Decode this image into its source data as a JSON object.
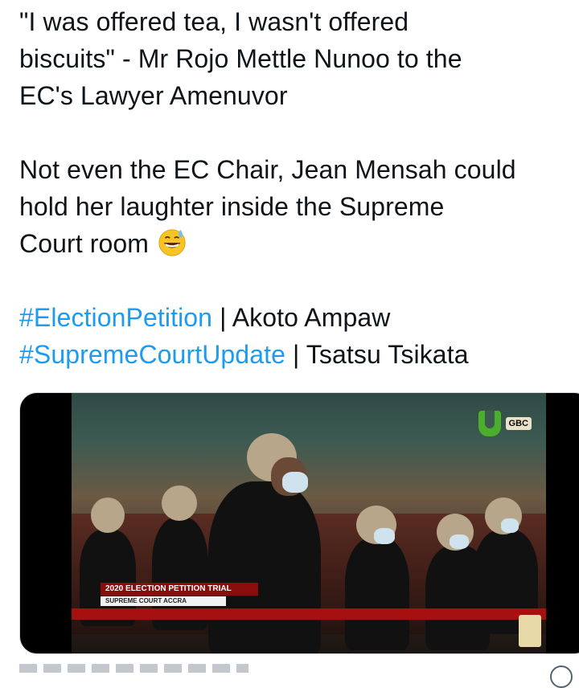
{
  "tweet": {
    "lines": [
      "\"I was offered tea, I wasn't offered",
      "biscuits\" - Mr Rojo Mettle Nunoo to the",
      "EC's Lawyer Amenuvor"
    ],
    "lines2": [
      "Not even the EC Chair, Jean Mensah could",
      "hold her laughter inside the Supreme",
      "Court room"
    ],
    "emoji_name": "grinning-face-with-sweat-icon",
    "tag1": "#ElectionPetition",
    "tag1_rest": " | Akoto Ampaw",
    "tag2": "#SupremeCourtUpdate",
    "tag2_rest": " | Tsatsu Tsikata"
  },
  "media": {
    "broadcaster": "GBC",
    "lower_third_title": "2020 ELECTION PETITION TRIAL",
    "lower_third_sub": "SUPREME COURT ACCRA"
  },
  "colors": {
    "hashtag": "#1d9bf0",
    "text": "#0f1419",
    "ticker": "#a61010",
    "title_bar": "#8a0d0d"
  }
}
